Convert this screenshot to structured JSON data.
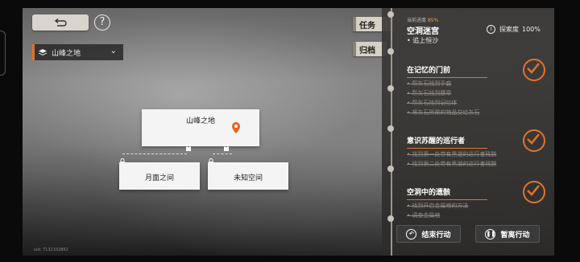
{
  "top": {
    "back_icon": "back-arrow-icon",
    "help_label": "?"
  },
  "region": {
    "name": "山峰之地"
  },
  "map": {
    "main_node": "山峰之地",
    "node_a": "月面之间",
    "node_b": "未知空间",
    "pin_color": "#e8641e"
  },
  "uid": "uid: 7132102862",
  "tabs": {
    "quest": "任务",
    "archive": "归档"
  },
  "quest": {
    "progress_label": "当前进度",
    "progress_pct": "85%",
    "title": "空洞迷宫",
    "subtitle": "• 追上恒沙",
    "explore_label": "探索度",
    "explore_pct": "100%",
    "sections": [
      {
        "title": "在记忆的门前",
        "items": [
          "• 帮灰石找到手套",
          "• 帮灰石找到腰章",
          "• 帮灰石找到记忆体",
          "• 将灰石所需的物品交给灰石"
        ]
      },
      {
        "title": "意识苏醒的巡行者",
        "items": [
          "• 找到第一处带有黑潮的巡行者残骸",
          "• 找到第二处带有黑潮的巡行者残骸"
        ]
      },
      {
        "title": "空洞中的遗骸",
        "items": [
          "• 找到开启金属棺的方法",
          "• 调查金属棺"
        ]
      }
    ]
  },
  "actions": {
    "end": "结束行动",
    "pause": "暂离行动"
  },
  "colors": {
    "accent": "#e0742c",
    "progress": "#f0a23c"
  }
}
